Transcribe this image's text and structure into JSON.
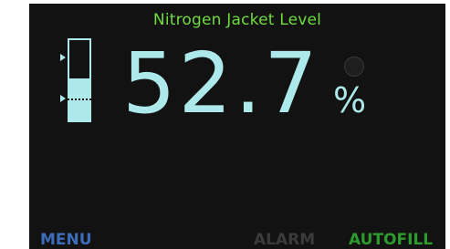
{
  "screen": {
    "title": "Nitrogen Jacket Level",
    "reading": "52.7",
    "unit": "%",
    "level_fraction": 0.527,
    "colors": {
      "title": "#6fdc3e",
      "reading": "#ade8ea",
      "menu": "#3d6cb8",
      "alarm": "#3b3b3b",
      "autofill": "#2d9a2d",
      "background": "#121212"
    }
  },
  "gauge": {
    "upper_marker_level": 0.78,
    "lower_marker_level": 0.27
  },
  "softkeys": {
    "menu": "MENU",
    "alarm": "ALARM",
    "autofill": "AUTOFILL"
  },
  "icons": {
    "status_indicator": "status-indicator-icon",
    "marker": "triangle-marker-icon"
  }
}
